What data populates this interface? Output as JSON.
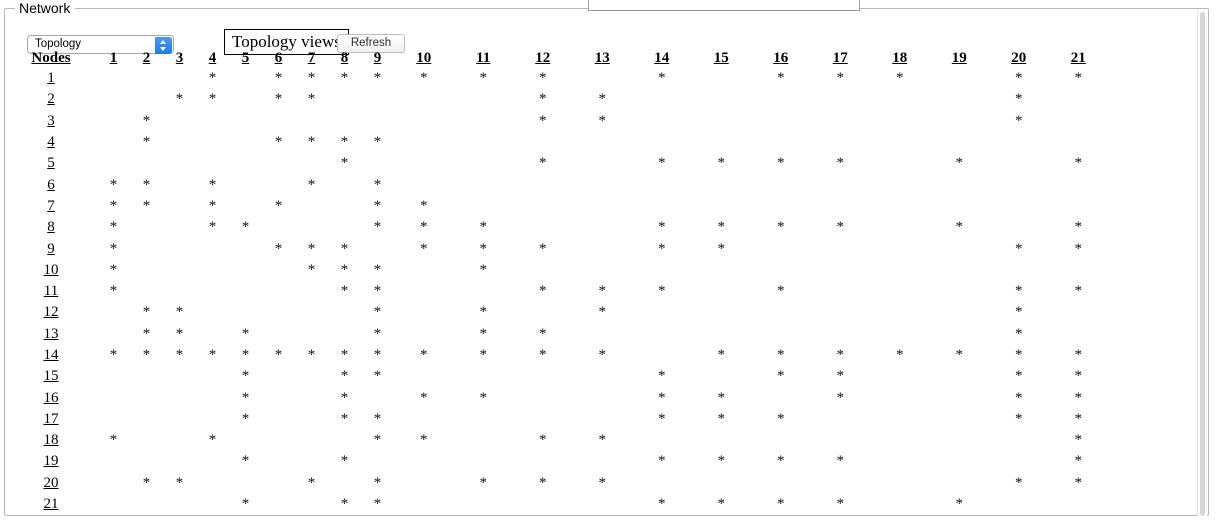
{
  "panel": {
    "legend": "Network"
  },
  "toolbar": {
    "topology_select": {
      "value": "Topology",
      "options": [
        "Topology"
      ]
    },
    "topology_views_label": "Topology views",
    "refresh_label": "Refresh"
  },
  "matrix": {
    "corner_header": "Nodes",
    "column_headers": [
      "1",
      "2",
      "3",
      "4",
      "5",
      "6",
      "7",
      "8",
      "9",
      "10",
      "11",
      "12",
      "13",
      "14",
      "15",
      "16",
      "17",
      "18",
      "19",
      "20",
      "21"
    ],
    "row_headers": [
      "1",
      "2",
      "3",
      "4",
      "5",
      "6",
      "7",
      "8",
      "9",
      "10",
      "11",
      "12",
      "13",
      "14",
      "15",
      "16",
      "17",
      "18",
      "19",
      "20",
      "21"
    ],
    "mark_glyph": "*",
    "rows": [
      {
        "label": "1",
        "marks": [
          4,
          6,
          7,
          8,
          9,
          10,
          11,
          12,
          14,
          16,
          17,
          18,
          20,
          21
        ]
      },
      {
        "label": "2",
        "marks": [
          3,
          4,
          6,
          7,
          12,
          13,
          20
        ]
      },
      {
        "label": "3",
        "marks": [
          2,
          12,
          13,
          20
        ]
      },
      {
        "label": "4",
        "marks": [
          2,
          6,
          7,
          8,
          9
        ]
      },
      {
        "label": "5",
        "marks": [
          8,
          12,
          14,
          15,
          16,
          17,
          19,
          21
        ]
      },
      {
        "label": "6",
        "marks": [
          1,
          2,
          4,
          7,
          9
        ]
      },
      {
        "label": "7",
        "marks": [
          1,
          2,
          4,
          6,
          9,
          10
        ]
      },
      {
        "label": "8",
        "marks": [
          1,
          4,
          5,
          9,
          10,
          11,
          14,
          15,
          16,
          17,
          19,
          21
        ]
      },
      {
        "label": "9",
        "marks": [
          1,
          6,
          7,
          8,
          10,
          11,
          12,
          14,
          15,
          20,
          21
        ]
      },
      {
        "label": "10",
        "marks": [
          1,
          7,
          8,
          9,
          11
        ]
      },
      {
        "label": "11",
        "marks": [
          1,
          8,
          9,
          12,
          13,
          14,
          16,
          20,
          21
        ]
      },
      {
        "label": "12",
        "marks": [
          2,
          3,
          9,
          11,
          13,
          20
        ]
      },
      {
        "label": "13",
        "marks": [
          2,
          3,
          5,
          9,
          11,
          12,
          20
        ]
      },
      {
        "label": "14",
        "marks": [
          1,
          2,
          3,
          4,
          5,
          6,
          7,
          8,
          9,
          10,
          11,
          12,
          13,
          15,
          16,
          17,
          18,
          19,
          20,
          21
        ]
      },
      {
        "label": "15",
        "marks": [
          5,
          8,
          9,
          14,
          16,
          17,
          20,
          21
        ]
      },
      {
        "label": "16",
        "marks": [
          5,
          8,
          10,
          11,
          14,
          15,
          17,
          20,
          21
        ]
      },
      {
        "label": "17",
        "marks": [
          5,
          8,
          9,
          14,
          15,
          16,
          20,
          21
        ]
      },
      {
        "label": "18",
        "marks": [
          1,
          4,
          9,
          10,
          12,
          13,
          21
        ]
      },
      {
        "label": "19",
        "marks": [
          5,
          8,
          14,
          15,
          16,
          17,
          21
        ]
      },
      {
        "label": "20",
        "marks": [
          2,
          3,
          7,
          9,
          11,
          12,
          13,
          20,
          21
        ]
      },
      {
        "label": "21",
        "marks": [
          5,
          8,
          9,
          14,
          15,
          16,
          17,
          19
        ]
      }
    ]
  }
}
